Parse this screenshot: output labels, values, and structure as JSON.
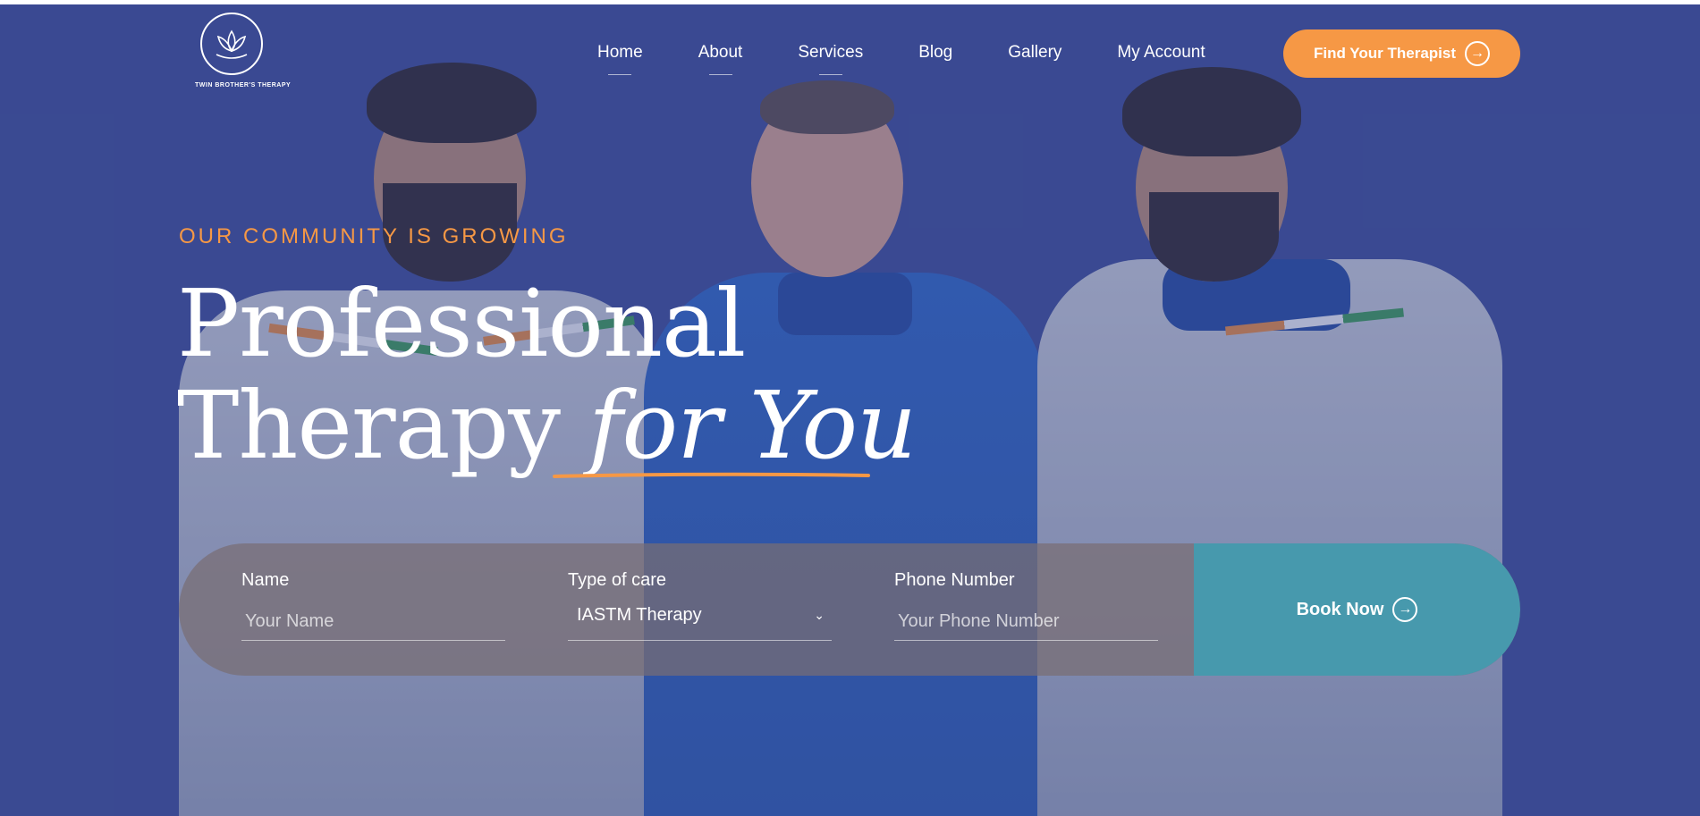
{
  "brand": {
    "name": "TWIN BROTHER'S THERAPY"
  },
  "nav": {
    "items": [
      {
        "label": "Home"
      },
      {
        "label": "About"
      },
      {
        "label": "Services"
      },
      {
        "label": "Blog"
      },
      {
        "label": "Gallery"
      },
      {
        "label": "My Account"
      }
    ],
    "cta_label": "Find Your Therapist"
  },
  "hero": {
    "eyebrow": "OUR COMMUNITY IS GROWING",
    "title_line1": "Professional",
    "title_line2_regular": "Therapy ",
    "title_line2_italic": "for You"
  },
  "booking": {
    "name_label": "Name",
    "name_placeholder": "Your Name",
    "care_label": "Type of care",
    "care_value": "IASTM Therapy",
    "phone_label": "Phone Number",
    "phone_placeholder": "Your Phone Number",
    "book_label": "Book Now"
  },
  "colors": {
    "background": "#3a4a92",
    "accent": "#f69845",
    "book_button": "#4799ad"
  }
}
